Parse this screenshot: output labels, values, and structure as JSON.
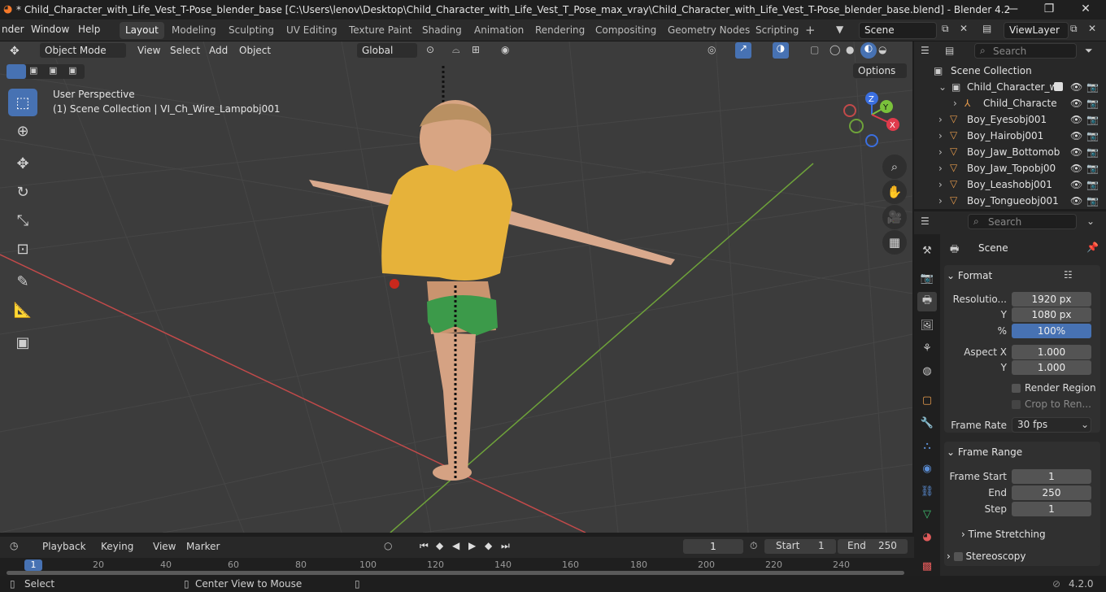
{
  "titlebar": {
    "title": "* Child_Character_with_Life_Vest_T-Pose_blender_base [C:\\Users\\lenov\\Desktop\\Child_Character_with_Life_Vest_T_Pose_max_vray\\Child_Character_with_Life_Vest_T-Pose_blender_base.blend] - Blender 4.2",
    "minimize": "—",
    "maximize": "❐",
    "close": "✕"
  },
  "menubar": {
    "items": [
      "nder",
      "Window",
      "Help"
    ]
  },
  "workspaces": [
    "Layout",
    "Modeling",
    "Sculpting",
    "UV Editing",
    "Texture Paint",
    "Shading",
    "Animation",
    "Rendering",
    "Compositing",
    "Geometry Nodes",
    "Scripting"
  ],
  "scene": {
    "value": "Scene"
  },
  "viewlayer": {
    "value": "ViewLayer"
  },
  "viewport": {
    "mode": "Object Mode",
    "menus": [
      "View",
      "Select",
      "Add",
      "Object"
    ],
    "orientation": "Global",
    "options_label": "Options",
    "perspective_text": "User Perspective",
    "collection_text": "(1) Scene Collection | VI_Ch_Wire_Lampobj001",
    "gizmo": {
      "x": "X",
      "y": "Y",
      "z": "Z"
    }
  },
  "outliner": {
    "search_placeholder": "Search",
    "rows": [
      {
        "label": "Scene Collection"
      },
      {
        "label": "Child_Character_wi"
      },
      {
        "label": "Child_Characte"
      },
      {
        "label": "Boy_Eyesobj001"
      },
      {
        "label": "Boy_Hairobj001"
      },
      {
        "label": "Boy_Jaw_Bottomob"
      },
      {
        "label": "Boy_Jaw_Topobj00"
      },
      {
        "label": "Boy_Leashobj001"
      },
      {
        "label": "Boy_Tongueobj001"
      }
    ]
  },
  "properties": {
    "search_placeholder": "Search",
    "context": "Scene",
    "format": {
      "title": "Format",
      "resolution_label": "Resolutio...",
      "res_x": "1920 px",
      "y_label": "Y",
      "res_y": "1080 px",
      "pct_label": "%",
      "pct": "100%",
      "aspect_x_label": "Aspect X",
      "aspect_x": "1.000",
      "aspect_y_label": "Y",
      "aspect_y": "1.000",
      "render_region": "Render Region",
      "crop": "Crop to Ren...",
      "frame_rate_label": "Frame Rate",
      "frame_rate": "30 fps"
    },
    "frame_range": {
      "title": "Frame Range",
      "start_label": "Frame Start",
      "start": "1",
      "end_label": "End",
      "end": "250",
      "step_label": "Step",
      "step": "1"
    },
    "time_stretching": "Time Stretching",
    "stereoscopy": "Stereoscopy"
  },
  "timeline": {
    "menus": [
      "Playback",
      "Keying",
      "View",
      "Marker"
    ],
    "current_frame": "1",
    "start_label": "Start",
    "start": "1",
    "end_label": "End",
    "end": "250",
    "ruler": [
      "1",
      "20",
      "40",
      "60",
      "80",
      "100",
      "120",
      "140",
      "160",
      "180",
      "200",
      "220",
      "240"
    ]
  },
  "statusbar": {
    "select": "Select",
    "center": "Center View to Mouse",
    "version": "4.2.0"
  },
  "colors": {
    "accent": "#4772b3",
    "x_axis": "#e03b4c",
    "y_axis": "#7ac23b",
    "z_axis": "#3b6fe0"
  }
}
